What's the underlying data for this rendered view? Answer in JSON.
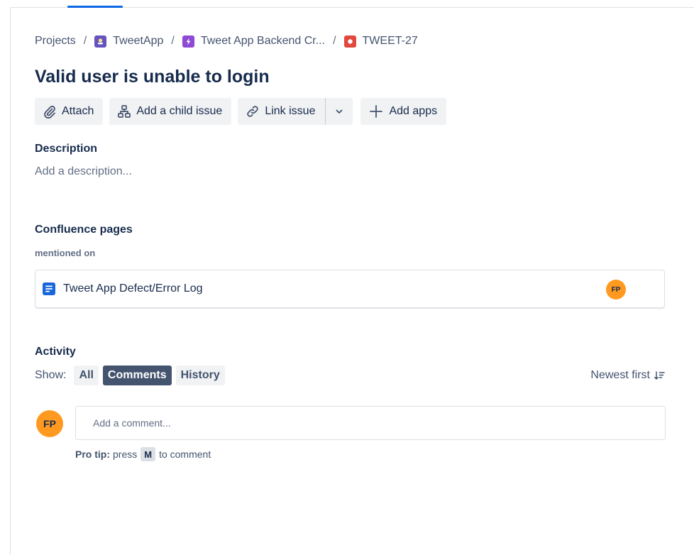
{
  "breadcrumb": {
    "items": [
      "Projects",
      "TweetApp",
      "Tweet App Backend Cr...",
      "TWEET-27"
    ],
    "separator": "/"
  },
  "issue": {
    "title": "Valid user is unable to login"
  },
  "toolbar": {
    "attach_label": "Attach",
    "child_issue_label": "Add a child issue",
    "link_issue_label": "Link issue",
    "add_apps_label": "Add apps"
  },
  "description": {
    "heading": "Description",
    "placeholder": "Add a description..."
  },
  "confluence": {
    "heading": "Confluence pages",
    "subheading": "mentioned on",
    "pages": [
      {
        "title": "Tweet App Defect/Error Log",
        "author_initials": "FP"
      }
    ]
  },
  "activity": {
    "heading": "Activity",
    "show_label": "Show:",
    "filters": [
      "All",
      "Comments",
      "History"
    ],
    "active_filter": "Comments",
    "sort_label": "Newest first",
    "user_initials": "FP",
    "comment_placeholder": "Add a comment...",
    "pro_tip_label": "Pro tip:",
    "pro_tip_press": "press",
    "pro_tip_key": "M",
    "pro_tip_suffix": "to comment"
  },
  "colors": {
    "accent": "#0c66e4",
    "avatar": "#ff991f",
    "bug": "#e2483d",
    "epic": "#8f4ad5",
    "project": "#6554c0",
    "confluence_page": "#1868db"
  }
}
